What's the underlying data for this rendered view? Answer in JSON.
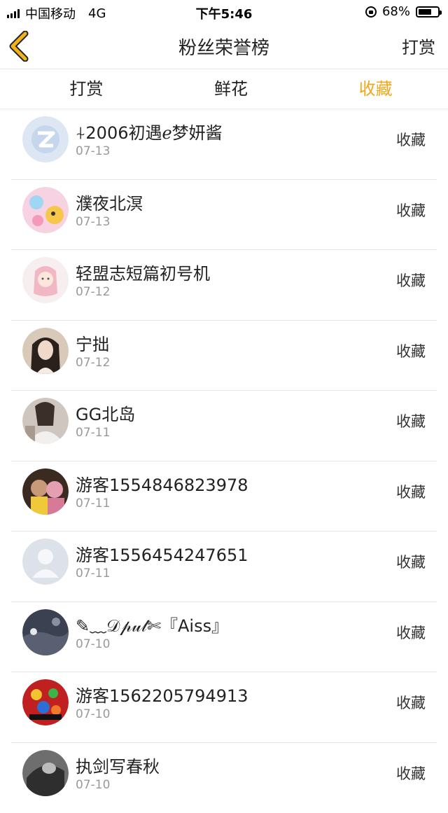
{
  "status": {
    "carrier": "中国移动",
    "network": "4G",
    "time": "下午5:46",
    "battery": "68%",
    "battery_level": 0.68
  },
  "nav": {
    "title": "粉丝荣誉榜",
    "action": "打赏"
  },
  "tabs": [
    {
      "label": "打赏",
      "active": false
    },
    {
      "label": "鲜花",
      "active": false
    },
    {
      "label": "收藏",
      "active": true
    }
  ],
  "colors": {
    "accent": "#f2a71b",
    "back_icon": "#f2b21b"
  },
  "list": [
    {
      "name": "⍭2006初遇ℯ梦妍酱",
      "date": "07-13",
      "action": "收藏",
      "avatar": "qq-star-avatar"
    },
    {
      "name": "濮夜北溟",
      "date": "07-13",
      "action": "收藏",
      "avatar": "cartoon-pikachu-avatar"
    },
    {
      "name": "轻盟志短篇初号机",
      "date": "07-12",
      "action": "收藏",
      "avatar": "anime-girl-avatar"
    },
    {
      "name": "宁拙",
      "date": "07-12",
      "action": "收藏",
      "avatar": "girl-photo-avatar"
    },
    {
      "name": "GG北岛",
      "date": "07-11",
      "action": "收藏",
      "avatar": "girl-photo-avatar"
    },
    {
      "name": "游客1554846823978",
      "date": "07-11",
      "action": "收藏",
      "avatar": "photo-avatar"
    },
    {
      "name": "游客1556454247651",
      "date": "07-11",
      "action": "收藏",
      "avatar": "default-user-avatar"
    },
    {
      "name": "✎﹏𝒟𝓅𝓊𝓁✄『Aiss』",
      "date": "07-10",
      "action": "收藏",
      "avatar": "dark-scene-avatar"
    },
    {
      "name": "游客1562205794913",
      "date": "07-10",
      "action": "收藏",
      "avatar": "colorful-poster-avatar"
    },
    {
      "name": "执剑写春秋",
      "date": "07-10",
      "action": "收藏",
      "avatar": "bw-photo-avatar"
    }
  ]
}
